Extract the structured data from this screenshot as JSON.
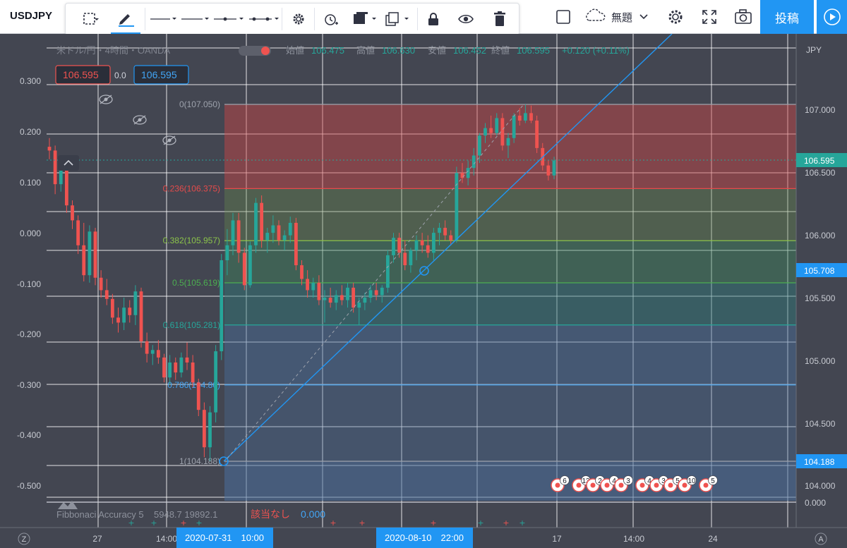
{
  "header": {
    "symbol": "USDJPY",
    "layout_name": "無題",
    "publish_label": "投稿"
  },
  "toolbar": {
    "icons": [
      "select-area-icon",
      "pencil-icon",
      "line-style-icon",
      "line-width-icon",
      "line-end-icon",
      "line-both-icon",
      "gear-icon",
      "alarm-icon",
      "template-icon",
      "clone-icon",
      "lock-icon",
      "eye-icon",
      "trash-icon"
    ]
  },
  "legend": {
    "title": "米ドル/円・4時間・OANDA",
    "ohlc": {
      "open_label": "始値",
      "open": "106.475",
      "high_label": "高値",
      "high": "106.630",
      "low_label": "安値",
      "low": "106.452",
      "close_label": "終値",
      "close": "106.595",
      "change": "+0.120 (+0.11%)"
    },
    "sell_price": "106.595",
    "spread": "0.0",
    "buy_price": "106.595",
    "currency": "JPY"
  },
  "indicator": {
    "name": "Fibbonaci Accuracy 5",
    "values": "5948.7  19892.1",
    "status": "該当なし",
    "value": "0.000"
  },
  "fib_levels": [
    {
      "label": "0(107.050)",
      "ratio": 0,
      "price": 107.05,
      "color": "#9ea3ad"
    },
    {
      "label": "0.236(106.375)",
      "ratio": 0.236,
      "price": 106.375,
      "color": "#e54b4b"
    },
    {
      "label": "0.382(105.957)",
      "ratio": 0.382,
      "price": 105.957,
      "color": "#8bc34a"
    },
    {
      "label": "0.5(105.619)",
      "ratio": 0.5,
      "price": 105.619,
      "color": "#4caf50"
    },
    {
      "label": "0.618(105.281)",
      "ratio": 0.618,
      "price": 105.281,
      "color": "#26a69a"
    },
    {
      "label": "0.786(104.80)",
      "ratio": 0.786,
      "price": 104.8,
      "color": "#42a5f5"
    },
    {
      "label": "1(104.188)",
      "ratio": 1,
      "price": 104.188,
      "color": "#9ea3ad"
    }
  ],
  "price_axis": {
    "labels": [
      "107.000",
      "106.500",
      "106.000",
      "105.500",
      "105.000",
      "104.500",
      "104.000"
    ],
    "current_price": "106.595",
    "line_price": "105.708",
    "fib_low": "104.188"
  },
  "left_axis": {
    "labels": [
      "0.300",
      "0.200",
      "0.100",
      "0.000",
      "-0.100",
      "-0.200",
      "-0.300",
      "-0.400",
      "-0.500"
    ],
    "indicator_zero": "0.000"
  },
  "time_axis": {
    "labels": [
      "27",
      "14:00",
      "17",
      "14:00",
      "24"
    ],
    "highlight_1": "2020-07-31　10:00",
    "highlight_2": "2020-08-10　22:00"
  },
  "events": [
    "6",
    "13",
    "2",
    "4",
    "3",
    "4",
    "3",
    "5",
    "10",
    "5"
  ],
  "corner_labels": {
    "left": "Z",
    "right": "A"
  },
  "chart_data": {
    "type": "candlestick",
    "symbol": "USDJPY",
    "candles": [
      {
        "o": 106.71,
        "h": 106.78,
        "l": 106.61,
        "c": 106.68
      },
      {
        "o": 106.68,
        "h": 106.72,
        "l": 106.33,
        "c": 106.41
      },
      {
        "o": 106.41,
        "h": 106.55,
        "l": 106.35,
        "c": 106.52
      },
      {
        "o": 106.52,
        "h": 106.55,
        "l": 106.18,
        "c": 106.24
      },
      {
        "o": 106.24,
        "h": 106.28,
        "l": 106.05,
        "c": 106.12
      },
      {
        "o": 106.12,
        "h": 106.16,
        "l": 105.85,
        "c": 105.92
      },
      {
        "o": 105.92,
        "h": 106.1,
        "l": 105.63,
        "c": 105.68
      },
      {
        "o": 105.68,
        "h": 106.08,
        "l": 105.62,
        "c": 106.03
      },
      {
        "o": 106.03,
        "h": 106.06,
        "l": 105.6,
        "c": 105.66
      },
      {
        "o": 105.66,
        "h": 105.72,
        "l": 105.5,
        "c": 105.56
      },
      {
        "o": 105.56,
        "h": 105.65,
        "l": 105.44,
        "c": 105.49
      },
      {
        "o": 105.49,
        "h": 105.53,
        "l": 105.29,
        "c": 105.34
      },
      {
        "o": 105.34,
        "h": 105.42,
        "l": 105.22,
        "c": 105.3
      },
      {
        "o": 105.3,
        "h": 105.5,
        "l": 105.24,
        "c": 105.42
      },
      {
        "o": 105.42,
        "h": 105.48,
        "l": 105.3,
        "c": 105.36
      },
      {
        "o": 105.36,
        "h": 105.6,
        "l": 105.28,
        "c": 105.55
      },
      {
        "o": 105.55,
        "h": 105.58,
        "l": 105.1,
        "c": 105.15
      },
      {
        "o": 105.15,
        "h": 105.22,
        "l": 104.98,
        "c": 105.05
      },
      {
        "o": 105.05,
        "h": 105.12,
        "l": 104.96,
        "c": 105.08
      },
      {
        "o": 105.08,
        "h": 105.16,
        "l": 104.97,
        "c": 105.02
      },
      {
        "o": 105.02,
        "h": 105.05,
        "l": 104.82,
        "c": 104.86
      },
      {
        "o": 104.86,
        "h": 105.04,
        "l": 104.8,
        "c": 104.98
      },
      {
        "o": 104.98,
        "h": 105.02,
        "l": 104.84,
        "c": 104.9
      },
      {
        "o": 104.9,
        "h": 105.06,
        "l": 104.86,
        "c": 105.02
      },
      {
        "o": 105.02,
        "h": 105.14,
        "l": 104.92,
        "c": 104.98
      },
      {
        "o": 104.98,
        "h": 105.04,
        "l": 104.78,
        "c": 104.82
      },
      {
        "o": 104.82,
        "h": 104.85,
        "l": 104.55,
        "c": 104.6
      },
      {
        "o": 104.6,
        "h": 104.66,
        "l": 104.22,
        "c": 104.3
      },
      {
        "o": 104.3,
        "h": 104.63,
        "l": 104.19,
        "c": 104.58
      },
      {
        "o": 104.58,
        "h": 105.12,
        "l": 104.5,
        "c": 105.07
      },
      {
        "o": 105.07,
        "h": 105.85,
        "l": 105.0,
        "c": 105.8
      },
      {
        "o": 105.8,
        "h": 106.05,
        "l": 105.68,
        "c": 105.92
      },
      {
        "o": 105.92,
        "h": 106.18,
        "l": 105.84,
        "c": 106.12
      },
      {
        "o": 106.12,
        "h": 106.18,
        "l": 105.78,
        "c": 105.86
      },
      {
        "o": 105.86,
        "h": 105.9,
        "l": 105.56,
        "c": 105.6
      },
      {
        "o": 105.6,
        "h": 105.95,
        "l": 105.58,
        "c": 105.92
      },
      {
        "o": 105.92,
        "h": 106.3,
        "l": 105.86,
        "c": 106.26
      },
      {
        "o": 106.26,
        "h": 106.32,
        "l": 105.9,
        "c": 105.96
      },
      {
        "o": 105.96,
        "h": 106.06,
        "l": 105.86,
        "c": 106.02
      },
      {
        "o": 106.02,
        "h": 106.16,
        "l": 105.94,
        "c": 106.08
      },
      {
        "o": 106.08,
        "h": 106.12,
        "l": 105.92,
        "c": 105.96
      },
      {
        "o": 105.96,
        "h": 106.04,
        "l": 105.88,
        "c": 106.0
      },
      {
        "o": 106.0,
        "h": 106.15,
        "l": 105.94,
        "c": 106.1
      },
      {
        "o": 106.1,
        "h": 106.14,
        "l": 105.72,
        "c": 105.76
      },
      {
        "o": 105.76,
        "h": 105.8,
        "l": 105.6,
        "c": 105.65
      },
      {
        "o": 105.65,
        "h": 105.72,
        "l": 105.5,
        "c": 105.56
      },
      {
        "o": 105.56,
        "h": 105.66,
        "l": 105.5,
        "c": 105.62
      },
      {
        "o": 105.62,
        "h": 105.68,
        "l": 105.44,
        "c": 105.48
      },
      {
        "o": 105.48,
        "h": 105.56,
        "l": 105.3,
        "c": 105.5
      },
      {
        "o": 105.5,
        "h": 105.58,
        "l": 105.42,
        "c": 105.46
      },
      {
        "o": 105.46,
        "h": 105.56,
        "l": 105.4,
        "c": 105.52
      },
      {
        "o": 105.52,
        "h": 105.6,
        "l": 105.44,
        "c": 105.48
      },
      {
        "o": 105.48,
        "h": 105.62,
        "l": 105.42,
        "c": 105.58
      },
      {
        "o": 105.58,
        "h": 105.62,
        "l": 105.38,
        "c": 105.42
      },
      {
        "o": 105.42,
        "h": 105.5,
        "l": 105.28,
        "c": 105.46
      },
      {
        "o": 105.46,
        "h": 105.54,
        "l": 105.4,
        "c": 105.5
      },
      {
        "o": 105.5,
        "h": 105.6,
        "l": 105.46,
        "c": 105.56
      },
      {
        "o": 105.56,
        "h": 105.62,
        "l": 105.48,
        "c": 105.52
      },
      {
        "o": 105.52,
        "h": 105.6,
        "l": 105.46,
        "c": 105.58
      },
      {
        "o": 105.58,
        "h": 105.88,
        "l": 105.54,
        "c": 105.84
      },
      {
        "o": 105.84,
        "h": 106.02,
        "l": 105.78,
        "c": 105.98
      },
      {
        "o": 105.98,
        "h": 106.02,
        "l": 105.82,
        "c": 105.86
      },
      {
        "o": 105.86,
        "h": 105.96,
        "l": 105.72,
        "c": 105.76
      },
      {
        "o": 105.76,
        "h": 105.9,
        "l": 105.7,
        "c": 105.88
      },
      {
        "o": 105.88,
        "h": 106.0,
        "l": 105.8,
        "c": 105.96
      },
      {
        "o": 105.96,
        "h": 106.02,
        "l": 105.86,
        "c": 105.92
      },
      {
        "o": 105.92,
        "h": 106.0,
        "l": 105.82,
        "c": 105.86
      },
      {
        "o": 105.86,
        "h": 106.06,
        "l": 105.8,
        "c": 106.02
      },
      {
        "o": 106.02,
        "h": 106.1,
        "l": 105.92,
        "c": 106.06
      },
      {
        "o": 106.06,
        "h": 106.12,
        "l": 105.96,
        "c": 106.0
      },
      {
        "o": 106.0,
        "h": 106.04,
        "l": 105.92,
        "c": 105.96
      },
      {
        "o": 105.96,
        "h": 106.55,
        "l": 105.94,
        "c": 106.5
      },
      {
        "o": 106.5,
        "h": 106.58,
        "l": 106.42,
        "c": 106.46
      },
      {
        "o": 106.46,
        "h": 106.6,
        "l": 106.4,
        "c": 106.54
      },
      {
        "o": 106.54,
        "h": 106.7,
        "l": 106.48,
        "c": 106.64
      },
      {
        "o": 106.64,
        "h": 106.82,
        "l": 106.58,
        "c": 106.8
      },
      {
        "o": 106.8,
        "h": 106.9,
        "l": 106.74,
        "c": 106.86
      },
      {
        "o": 106.86,
        "h": 106.96,
        "l": 106.78,
        "c": 106.82
      },
      {
        "o": 106.82,
        "h": 106.98,
        "l": 106.8,
        "c": 106.94
      },
      {
        "o": 106.94,
        "h": 106.98,
        "l": 106.68,
        "c": 106.72
      },
      {
        "o": 106.72,
        "h": 106.82,
        "l": 106.62,
        "c": 106.78
      },
      {
        "o": 106.78,
        "h": 106.98,
        "l": 106.74,
        "c": 106.96
      },
      {
        "o": 106.96,
        "h": 107.02,
        "l": 106.88,
        "c": 106.92
      },
      {
        "o": 106.92,
        "h": 107.05,
        "l": 106.9,
        "c": 106.98
      },
      {
        "o": 106.98,
        "h": 107.04,
        "l": 106.9,
        "c": 106.92
      },
      {
        "o": 106.92,
        "h": 106.96,
        "l": 106.66,
        "c": 106.7
      },
      {
        "o": 106.7,
        "h": 106.74,
        "l": 106.52,
        "c": 106.56
      },
      {
        "o": 106.56,
        "h": 106.6,
        "l": 106.44,
        "c": 106.48
      },
      {
        "o": 106.48,
        "h": 106.63,
        "l": 106.45,
        "c": 106.6
      }
    ]
  }
}
